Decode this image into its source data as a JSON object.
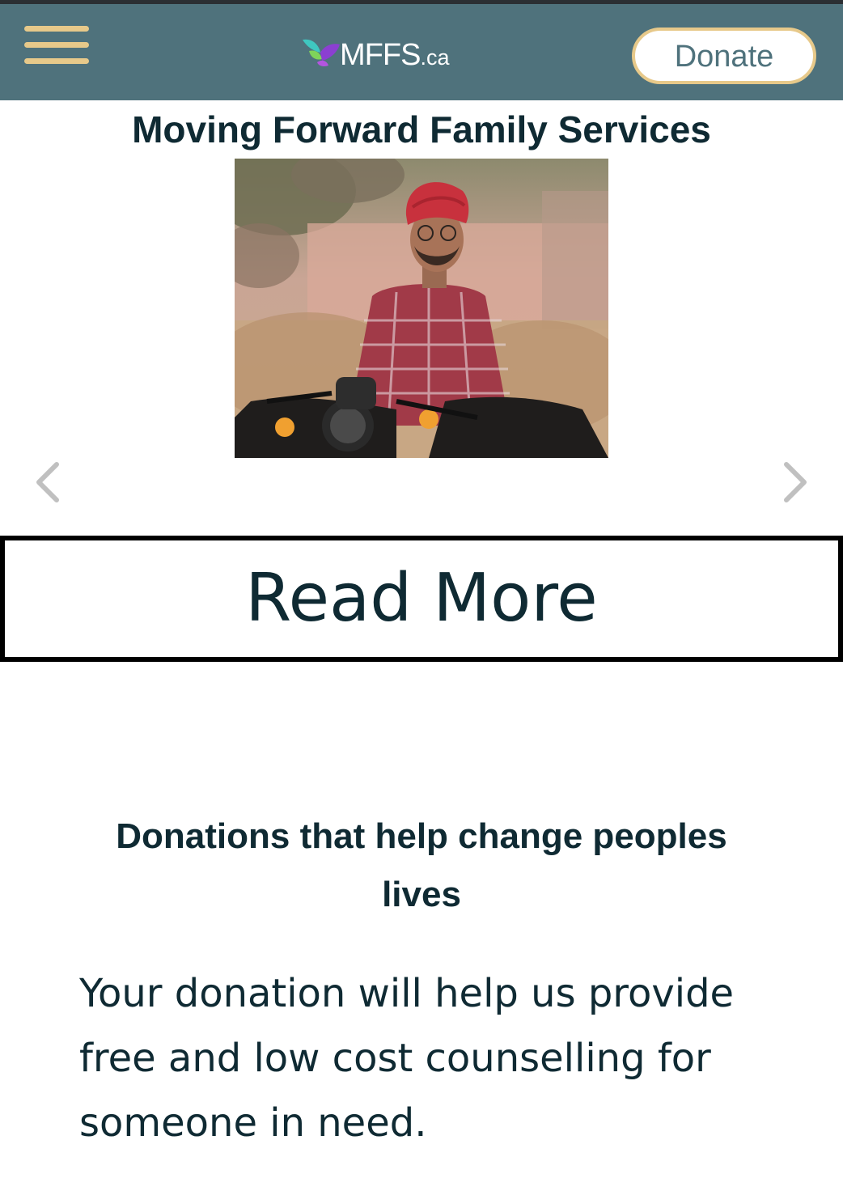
{
  "header": {
    "logo_main": "MFFS",
    "logo_suffix": ".ca",
    "donate_label": "Donate",
    "menu_icon": "hamburger-menu-icon",
    "colors": {
      "background": "#4f727c",
      "accent": "#e7c98a"
    }
  },
  "hero": {
    "title": "Moving Forward Family Services",
    "prev_icon": "chevron-left-icon",
    "next_icon": "chevron-right-icon",
    "read_more_label": "Read More"
  },
  "donations": {
    "heading": "Donations that help change peoples lives",
    "body": "Your donation will help us provide free and low cost counselling for someone in need."
  }
}
